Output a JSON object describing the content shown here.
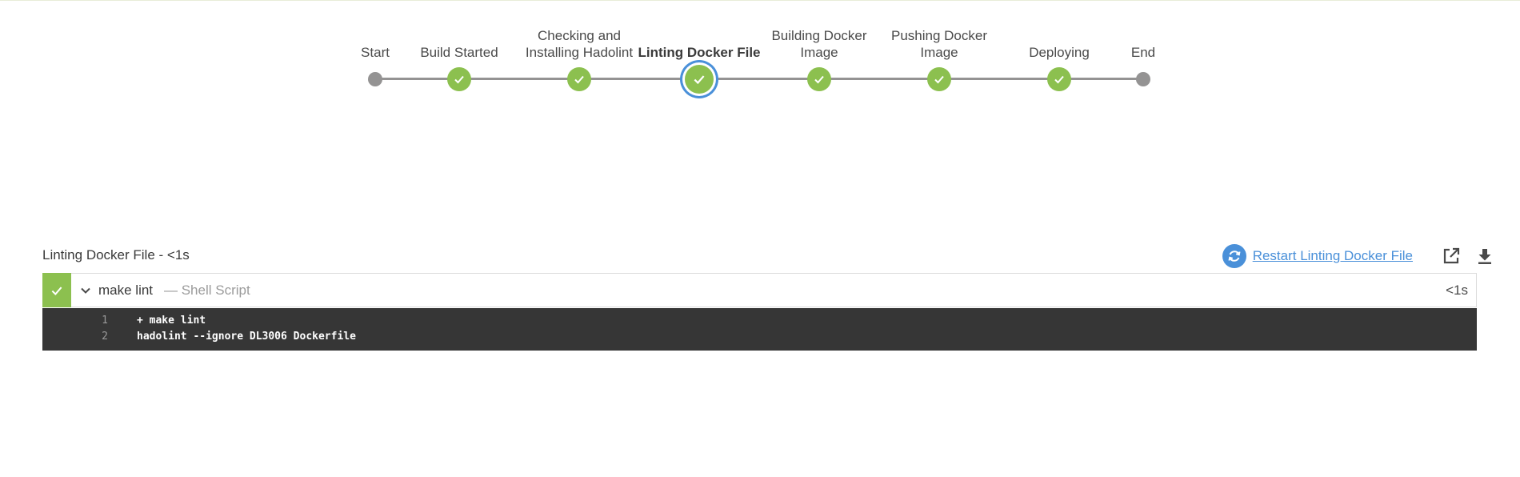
{
  "pipeline": {
    "stages": [
      {
        "label": "Start",
        "status": "start"
      },
      {
        "label": "Build Started",
        "status": "success"
      },
      {
        "label": "Checking and Installing Hadolint",
        "status": "success"
      },
      {
        "label": "Linting Docker File",
        "status": "success",
        "selected": true
      },
      {
        "label": "Building Docker Image",
        "status": "success"
      },
      {
        "label": "Pushing Docker Image",
        "status": "success"
      },
      {
        "label": "Deploying",
        "status": "success"
      },
      {
        "label": "End",
        "status": "end"
      }
    ]
  },
  "step_header": {
    "title": "Linting Docker File - <1s",
    "restart_label": "Restart Linting Docker File",
    "icons": [
      "restart-icon",
      "open-external-icon",
      "download-icon"
    ]
  },
  "step": {
    "name": "make lint",
    "type": "— Shell Script",
    "duration": "<1s",
    "status": "success"
  },
  "log": {
    "lines": [
      {
        "number": "1",
        "text": "+ make lint"
      },
      {
        "number": "2",
        "text": "hadolint --ignore DL3006 Dockerfile"
      }
    ]
  },
  "colors": {
    "success": "#8cc04f",
    "selected_ring": "#4a90d9",
    "link": "#4a90d9",
    "track": "#949393",
    "log_background": "#363636"
  }
}
